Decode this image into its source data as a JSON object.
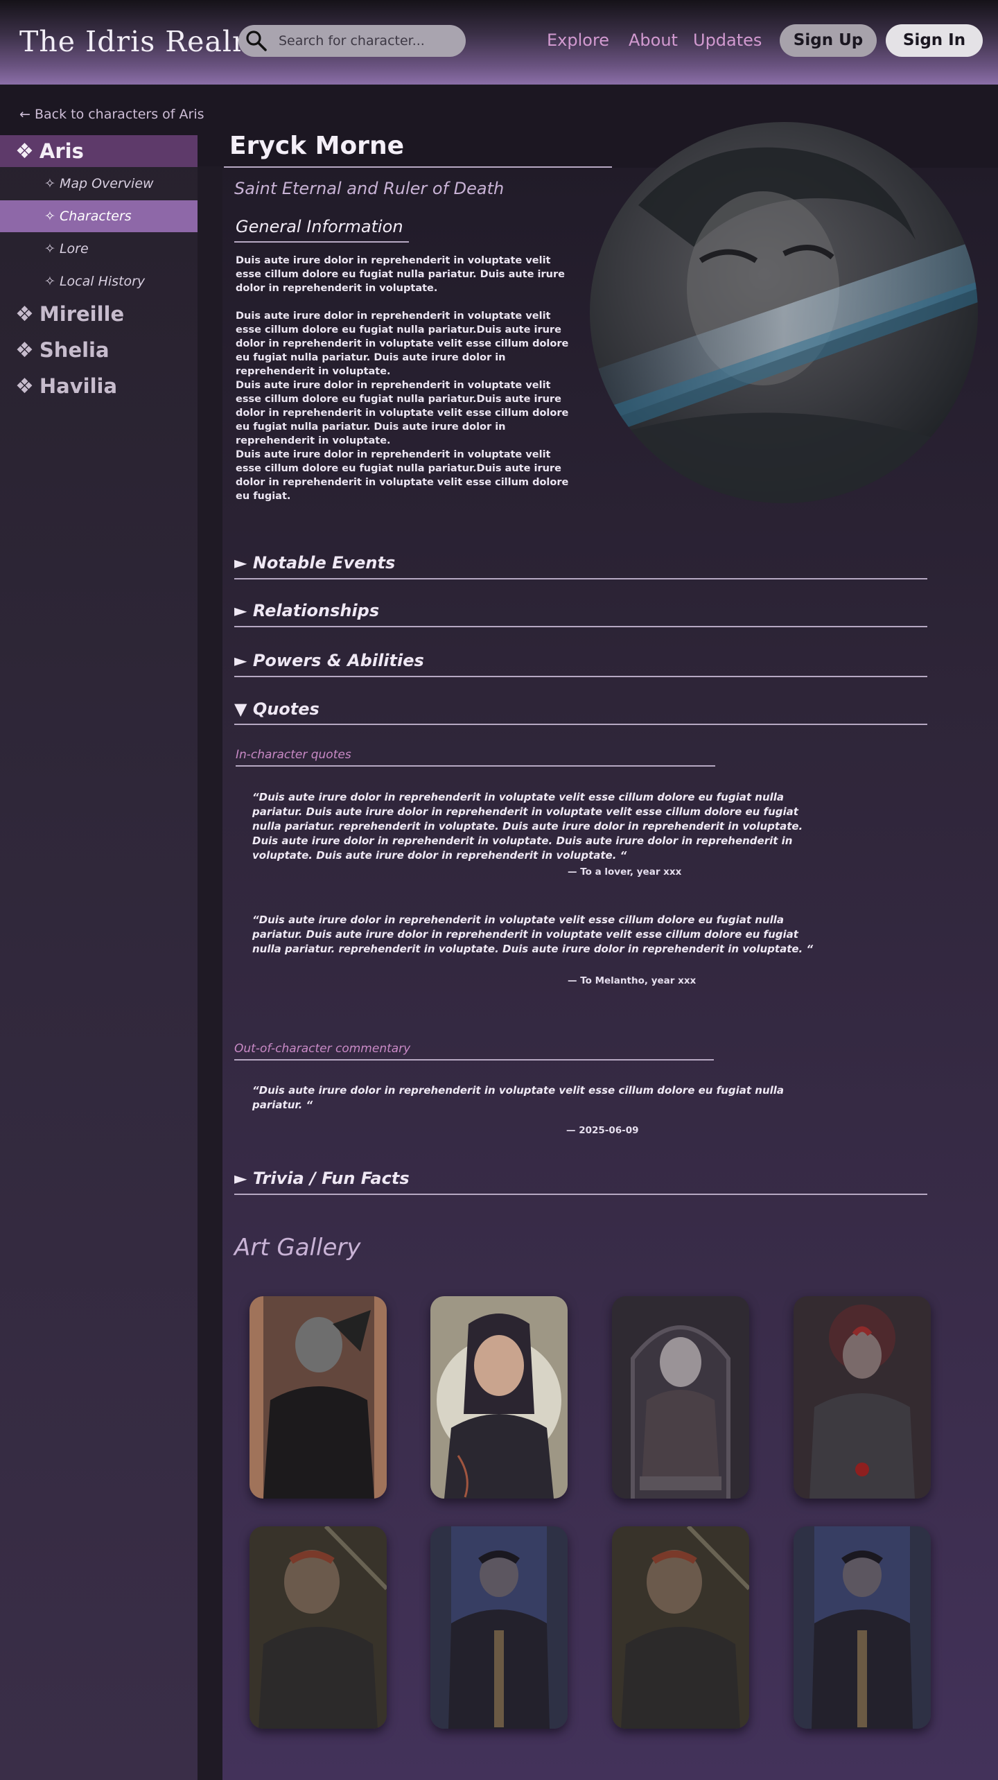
{
  "header": {
    "logo": "The Idris Realm",
    "search_placeholder": "Search for character...",
    "nav": [
      "Explore",
      "About",
      "Updates"
    ],
    "signup_label": "Sign Up",
    "signin_label": "Sign In"
  },
  "back_link": "← Back to characters of Aris",
  "sidebar": {
    "regions": [
      {
        "glyph": "❖",
        "label": "Aris",
        "active": true
      },
      {
        "glyph": "❖",
        "label": "Mireille"
      },
      {
        "glyph": "❖",
        "label": "Shelia"
      },
      {
        "glyph": "❖",
        "label": "Havilia"
      }
    ],
    "subitems": [
      {
        "label": "✧ Map Overview"
      },
      {
        "label": "✧ Characters",
        "active": true
      },
      {
        "label": "✧ Lore"
      },
      {
        "label": "✧ Local History"
      }
    ]
  },
  "character": {
    "name": "Eryck Morne",
    "subtitle": "Saint Eternal and Ruler of Death",
    "general_title": "General Information",
    "paragraphs": [
      "Duis aute irure dolor in reprehenderit in voluptate velit esse cillum dolore eu fugiat nulla pariatur. Duis aute irure dolor in reprehenderit in voluptate.",
      "Duis aute irure dolor in reprehenderit in voluptate velit esse cillum dolore eu fugiat nulla pariatur.Duis aute irure dolor in reprehenderit in voluptate velit esse cillum dolore eu fugiat nulla pariatur. Duis aute irure dolor in reprehenderit in voluptate.",
      "Duis aute irure dolor in reprehenderit in voluptate velit esse cillum dolore eu fugiat nulla pariatur.Duis aute irure dolor in reprehenderit in voluptate velit esse cillum dolore eu fugiat nulla pariatur. Duis aute irure dolor in reprehenderit in voluptate.",
      "Duis aute irure dolor in reprehenderit in voluptate velit esse cillum dolore eu fugiat nulla pariatur.Duis aute irure dolor in reprehenderit in voluptate velit esse cillum dolore eu fugiat."
    ]
  },
  "sections": {
    "notable": "► Notable Events",
    "relationships": "► Relationships",
    "powers": "► Powers & Abilities",
    "quotes": "▼ Quotes",
    "trivia": "► Trivia / Fun Facts"
  },
  "quotes": {
    "in_character_title": "In-character quotes",
    "items": [
      {
        "text": "“Duis aute irure dolor in reprehenderit in voluptate velit esse cillum dolore eu fugiat nulla pariatur. Duis aute irure dolor in reprehenderit in voluptate velit esse cillum dolore eu fugiat nulla pariatur. reprehenderit in voluptate. Duis aute irure dolor in reprehenderit in voluptate. Duis aute irure dolor in reprehenderit in voluptate. Duis aute irure dolor in reprehenderit in voluptate. Duis aute irure dolor in reprehenderit in voluptate. “",
        "attribution": "— To a lover, year xxx"
      },
      {
        "text": "“Duis aute irure dolor in reprehenderit in voluptate velit esse cillum dolore eu fugiat nulla pariatur. Duis aute irure dolor in reprehenderit in voluptate velit esse cillum dolore eu fugiat nulla pariatur. reprehenderit in voluptate. Duis aute irure dolor in reprehenderit in voluptate. “",
        "attribution": "— To Melantho, year xxx"
      }
    ],
    "ooc_title": "Out-of-character commentary",
    "ooc_text": "“Duis aute irure dolor in reprehenderit in voluptate velit esse cillum dolore eu fugiat nulla pariatur. “",
    "ooc_attribution": "— 2025-06-09"
  },
  "gallery": {
    "title": "Art Gallery"
  },
  "colors": {
    "accent_pink": "#d29ad0",
    "sidebar_active_region": "#5e3a6a",
    "sidebar_active_sub": "#8e68a8"
  }
}
